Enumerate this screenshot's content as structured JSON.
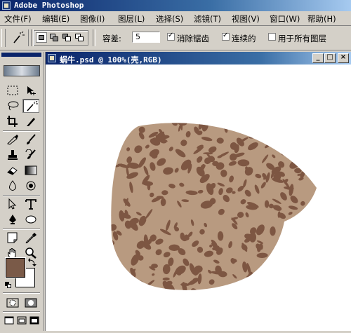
{
  "app": {
    "title": "Adobe Photoshop",
    "app_icon": "photoshop-eye-icon"
  },
  "menu": [
    {
      "label": "文件(F)"
    },
    {
      "label": "编辑(E)"
    },
    {
      "label": "图像(I)"
    },
    {
      "label": "图层(L)"
    },
    {
      "label": "选择(S)"
    },
    {
      "label": "滤镜(T)"
    },
    {
      "label": "视图(V)"
    },
    {
      "label": "窗口(W)"
    },
    {
      "label": "帮助(H)"
    }
  ],
  "options_bar": {
    "current_tool_icon": "magic-wand-icon",
    "selection_modes": [
      "new-selection-icon",
      "add-to-selection-icon",
      "subtract-from-selection-icon",
      "intersect-selection-icon"
    ],
    "active_selection_mode_index": 0,
    "tolerance_label": "容差:",
    "tolerance_value": "5",
    "antialias": {
      "label": "消除锯齿",
      "checked": true,
      "mark": "✓"
    },
    "contiguous": {
      "label": "连续的",
      "checked": true,
      "mark": "✓"
    },
    "sample_all_layers": {
      "label": "用于所有图层",
      "checked": false,
      "mark": ""
    }
  },
  "toolbox": {
    "tools": [
      "rectangular-marquee-icon",
      "move-icon",
      "lasso-icon",
      "magic-wand-icon",
      "crop-icon",
      "slice-icon",
      "healing-brush-icon",
      "brush-icon",
      "clone-stamp-icon",
      "history-brush-icon",
      "eraser-icon",
      "gradient-icon",
      "blur-icon",
      "dodge-icon",
      "path-selection-icon",
      "type-icon",
      "pen-icon",
      "ellipse-icon",
      "notes-icon",
      "eyedropper-icon",
      "hand-icon",
      "zoom-icon"
    ],
    "active_tool": "magic-wand-icon",
    "foreground_color": "#7a5a48",
    "background_color": "#ffffff",
    "mode_icons": [
      "standard-mode-icon",
      "quick-mask-mode-icon"
    ],
    "screen_icons": [
      "standard-screen-icon",
      "full-screen-menu-icon",
      "full-screen-icon"
    ]
  },
  "document": {
    "title": "蜗牛.psd @ 100%(壳,RGB)",
    "icon": "document-icon",
    "window_buttons": [
      {
        "name": "minimize-button",
        "glyph": "_"
      },
      {
        "name": "maximize-button",
        "glyph": "□"
      },
      {
        "name": "close-button",
        "glyph": "×"
      }
    ],
    "canvas_background": "#ffffff"
  },
  "artwork": {
    "name": "snail-shell",
    "base_color": "#b89a80",
    "spot_color": "#7d5642"
  }
}
